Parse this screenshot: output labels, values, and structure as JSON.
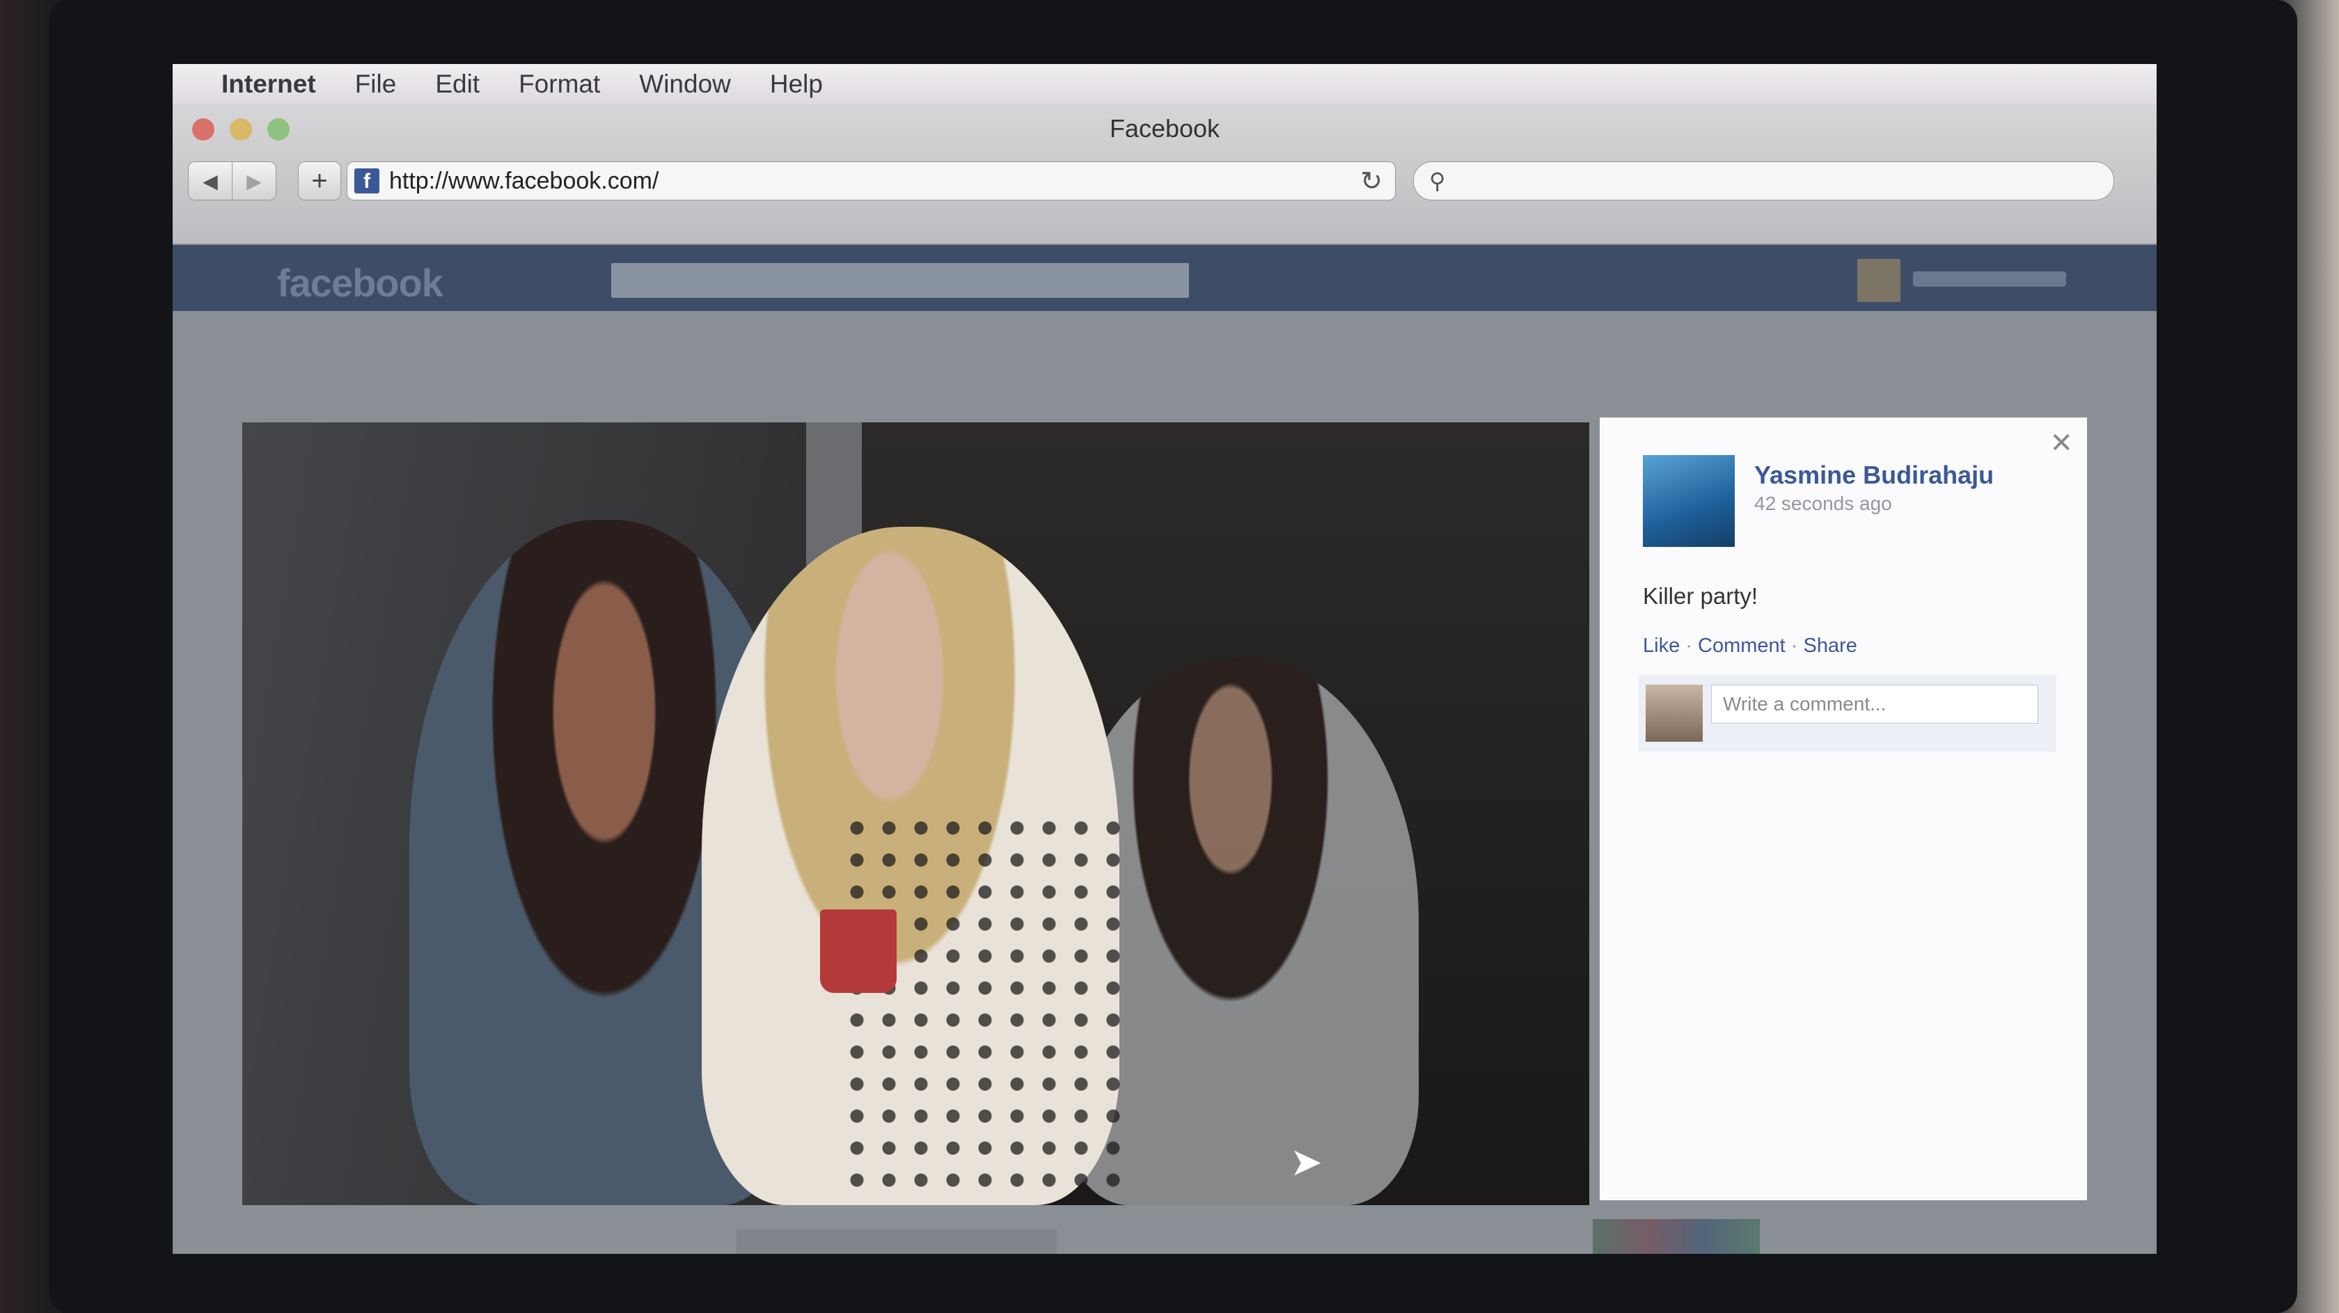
{
  "menubar": {
    "app": "Internet",
    "items": [
      "File",
      "Edit",
      "Format",
      "Window",
      "Help"
    ]
  },
  "window": {
    "title": "Facebook"
  },
  "toolbar": {
    "url": "http://www.facebook.com/",
    "back_icon": "◀",
    "forward_icon": "▶",
    "add_icon": "+",
    "reload_icon": "↻",
    "search_icon": "⚲"
  },
  "facebook": {
    "logo": "facebook"
  },
  "post": {
    "author": "Yasmine Budirahaju",
    "time": "42 seconds ago",
    "caption": "Killer party!",
    "actions": {
      "like": "Like",
      "comment": "Comment",
      "share": "Share",
      "separator": "·"
    },
    "comment_placeholder": "Write a comment...",
    "close_icon": "✕"
  },
  "colors": {
    "facebook_blue": "#3b5998",
    "fb_bar": "#3d4d68",
    "panel_bg": "#fbfbfd"
  }
}
